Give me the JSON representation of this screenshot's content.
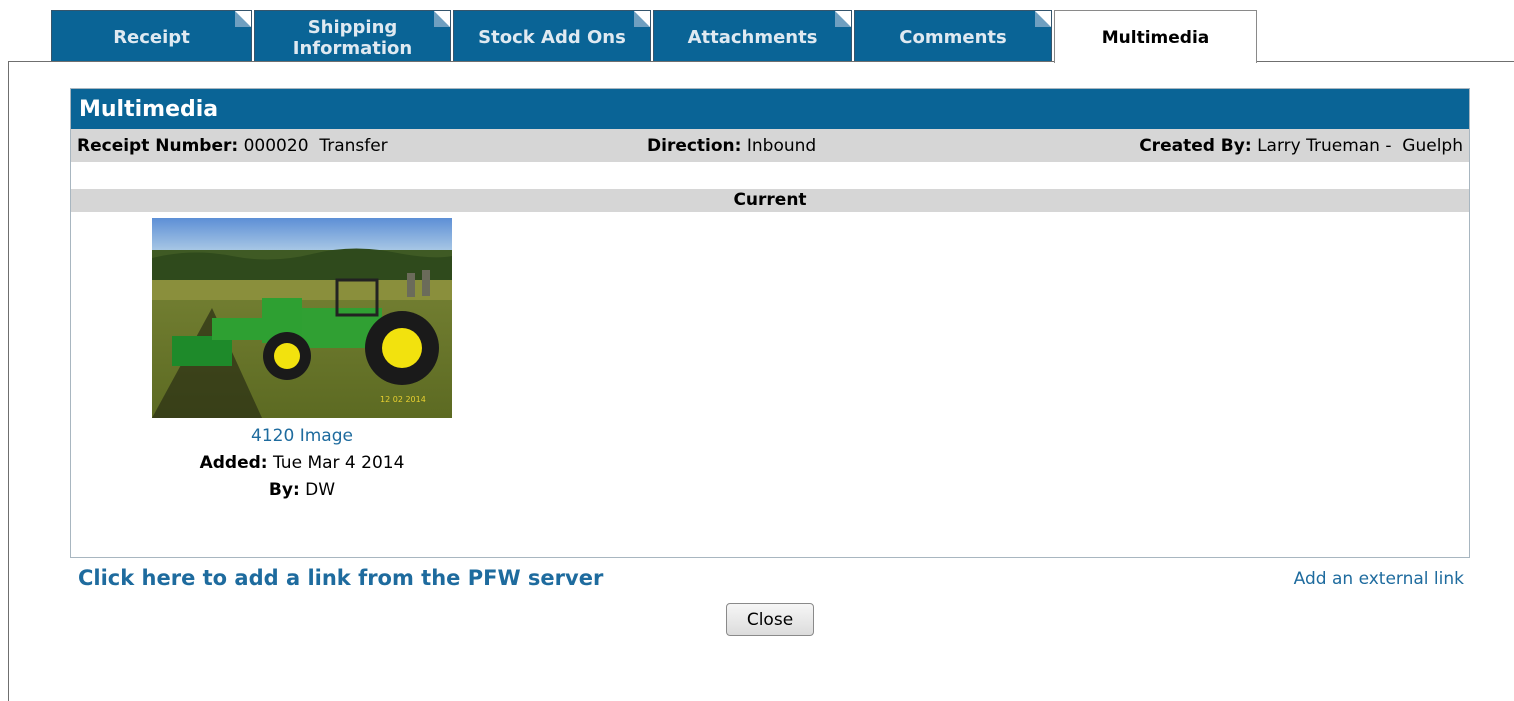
{
  "tabs": [
    {
      "label": "Receipt",
      "active": false
    },
    {
      "label_line1": "Shipping",
      "label_line2": "Information",
      "active": false
    },
    {
      "label": "Stock Add Ons",
      "active": false
    },
    {
      "label": "Attachments",
      "active": false
    },
    {
      "label": "Comments",
      "active": false
    },
    {
      "label": "Multimedia",
      "active": true
    }
  ],
  "panel": {
    "title": "Multimedia",
    "receipt_number_label": "Receipt Number:",
    "receipt_number_value": "000020  Transfer",
    "direction_label": "Direction:",
    "direction_value": "Inbound",
    "created_by_label": "Created By:",
    "created_by_value": "Larry Trueman -  Guelph",
    "current_label": "Current"
  },
  "media_items": [
    {
      "caption": "4120 Image",
      "added_label": "Added:",
      "added_value": "Tue Mar 4 2014",
      "by_label": "By:",
      "by_value": "DW",
      "thumb_stamp": "12 02 2014"
    }
  ],
  "links": {
    "pfw_server": "Click here to add a link from the PFW server",
    "external": "Add an external link"
  },
  "buttons": {
    "close": "Close"
  },
  "colors": {
    "tab_blue": "#0a6496",
    "link_blue": "#1e6b9e",
    "row_grey": "#d6d6d6"
  }
}
